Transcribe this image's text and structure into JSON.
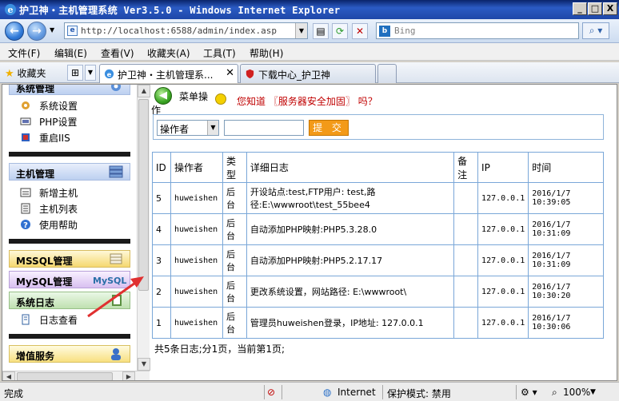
{
  "window": {
    "title": "护卫神・主机管理系统 Ver3.5.0 - Windows Internet Explorer",
    "minimize": "_",
    "maximize": "□",
    "close": "X"
  },
  "address": {
    "url": "http://localhost:6588/admin/index.asp",
    "search_placeholder": "Bing"
  },
  "menu": {
    "file": "文件(F)",
    "edit": "编辑(E)",
    "view": "查看(V)",
    "favorites": "收藏夹(A)",
    "tools": "工具(T)",
    "help": "帮助(H)"
  },
  "tabbar": {
    "favorites_label": "收藏夹",
    "tab1": "护卫神・主机管理系...",
    "tab2": "下载中心_护卫神"
  },
  "sidebar": {
    "sys_mgmt": "系统管理",
    "sys_items": [
      "系统设置",
      "PHP设置",
      "重启IIS"
    ],
    "host_mgmt": "主机管理",
    "host_items": [
      "新增主机",
      "主机列表",
      "使用帮助"
    ],
    "mssql": "MSSQL管理",
    "mysql": "MySQL管理",
    "syslog": "系统日志",
    "log_items": [
      "日志查看"
    ],
    "value_added": "增值服务"
  },
  "main": {
    "menu_op_a": "菜单操",
    "menu_op_b": "作",
    "tip_prefix": "您知道",
    "tip_link": "〖服务器安全加固〗",
    "tip_suffix": "吗？",
    "filter_select": "操作者",
    "submit_label": "提 交",
    "table": {
      "headers": [
        "ID",
        "操作者",
        "类型",
        "详细日志",
        "备注",
        "IP",
        "时间"
      ],
      "rows": [
        {
          "id": "5",
          "op": "huweishen",
          "type": "后台",
          "detail": "开设站点:test,FTP用户: test,路径:E:\\wwwroot\\test_55bee4",
          "note": "",
          "ip": "127.0.0.1",
          "time": "2016/1/7 10:39:05"
        },
        {
          "id": "4",
          "op": "huweishen",
          "type": "后台",
          "detail": "自动添加PHP映射:PHP5.3.28.0",
          "note": "",
          "ip": "127.0.0.1",
          "time": "2016/1/7 10:31:09"
        },
        {
          "id": "3",
          "op": "huweishen",
          "type": "后台",
          "detail": "自动添加PHP映射:PHP5.2.17.17",
          "note": "",
          "ip": "127.0.0.1",
          "time": "2016/1/7 10:31:09"
        },
        {
          "id": "2",
          "op": "huweishen",
          "type": "后台",
          "detail": "更改系统设置，网站路径: E:\\wwwroot\\",
          "note": "",
          "ip": "127.0.0.1",
          "time": "2016/1/7 10:30:20"
        },
        {
          "id": "1",
          "op": "huweishen",
          "type": "后台",
          "detail": "管理员huweishen登录，IP地址: 127.0.0.1",
          "note": "",
          "ip": "127.0.0.1",
          "time": "2016/1/7 10:30:06"
        }
      ]
    },
    "summary": "共5条日志;分1页，当前第1页;"
  },
  "status": {
    "done": "完成",
    "zone": "Internet",
    "protected": "保护模式: 禁用",
    "zoom": "100%"
  }
}
